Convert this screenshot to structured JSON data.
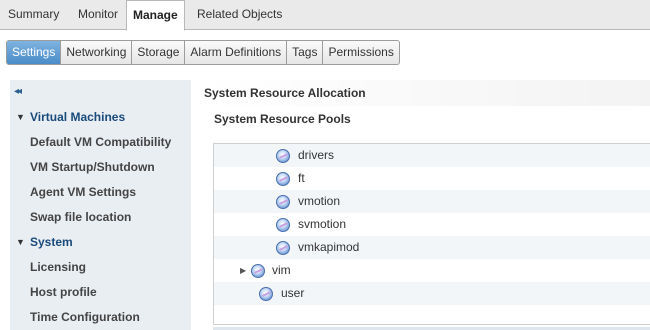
{
  "top_tabs": [
    "Summary",
    "Monitor",
    "Manage",
    "Related Objects"
  ],
  "sub_tabs": [
    "Settings",
    "Networking",
    "Storage",
    "Alarm Definitions",
    "Tags",
    "Permissions"
  ],
  "left_nav": {
    "collapse_glyph": "◂◂",
    "groups": [
      {
        "label": "Virtual Machines",
        "items": [
          "Default VM Compatibility",
          "VM Startup/Shutdown",
          "Agent VM Settings",
          "Swap file location"
        ]
      },
      {
        "label": "System",
        "items": [
          "Licensing",
          "Host profile",
          "Time Configuration"
        ]
      }
    ]
  },
  "content": {
    "section_title": "System Resource Allocation",
    "pools_title": "System Resource Pools",
    "tree": [
      {
        "label": "drivers"
      },
      {
        "label": "ft"
      },
      {
        "label": "vmotion"
      },
      {
        "label": "svmotion"
      },
      {
        "label": "vmkapimod"
      },
      {
        "label": "vim"
      },
      {
        "label": "user"
      }
    ]
  },
  "icons": {
    "resource_pool": "resource-pool-icon",
    "expand": "expand-triangle-icon",
    "collapse": "collapse-triangle-icon"
  },
  "colors": {
    "active_subtab": "#4a8cc9",
    "nav_bg": "#e9eef3",
    "group_label": "#1a4a7a"
  }
}
